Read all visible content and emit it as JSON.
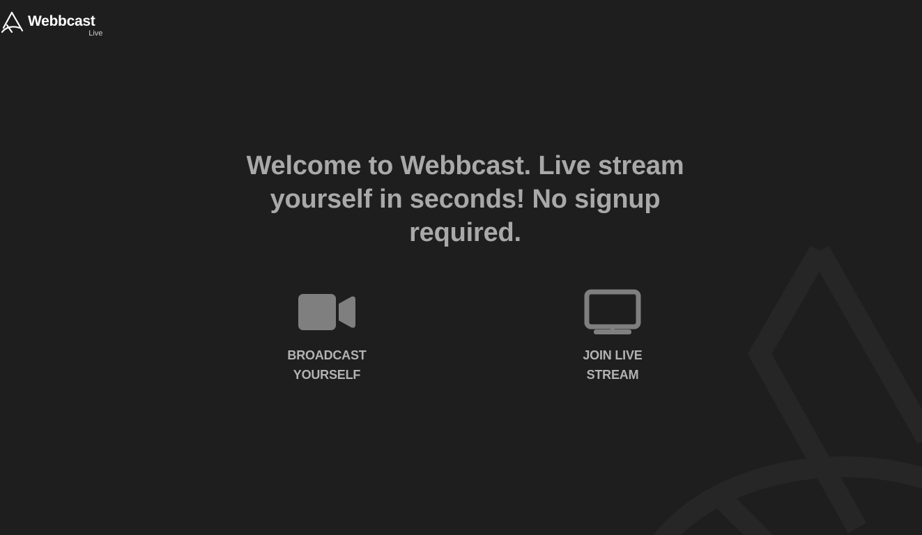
{
  "brand": {
    "name": "Webbcast",
    "sub": "Live",
    "icon": "webbcast-logo-icon"
  },
  "hero": {
    "line1": "Welcome to Webbcast. Live stream",
    "line2": "yourself in seconds! No signup",
    "line3": "required."
  },
  "actions": {
    "broadcast": {
      "icon": "video-camera-icon",
      "line1": "BROADCAST",
      "line2": "YOURSELF"
    },
    "join": {
      "icon": "monitor-icon",
      "line1": "JOIN LIVE",
      "line2": "STREAM"
    }
  },
  "colors": {
    "background": "#1e1e1e",
    "brand_text": "#ffffff",
    "hero_text": "#a9a9a9",
    "action_text": "#b3b3b3",
    "icon_fill": "#7f7f7f",
    "watermark": "#262626"
  }
}
